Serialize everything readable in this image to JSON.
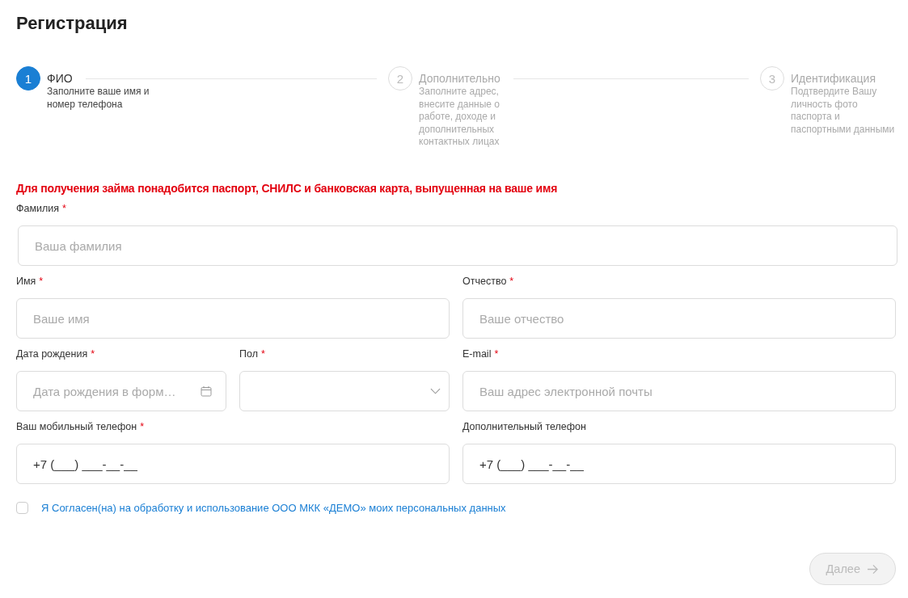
{
  "title": "Регистрация",
  "steps": [
    {
      "number": "1",
      "title": "ФИО",
      "description": "Заполните ваше имя и номер телефона",
      "active": true
    },
    {
      "number": "2",
      "title": "Дополнительно",
      "description": "Заполните адрес, внесите данные о работе, доходе и дополнительных контактных лицах",
      "active": false
    },
    {
      "number": "3",
      "title": "Идентификация",
      "description": "Подтвердите Вашу личность фото паспорта и паспортными данными",
      "active": false
    }
  ],
  "notice": "Для получения займа понадобится паспорт, СНИЛС и банковская карта, выпущенная на ваше имя",
  "field_rows": [
    [
      {
        "kind": "text",
        "label": "Фамилия",
        "required_mark": "*",
        "placeholder": "Ваша фамилия"
      }
    ],
    [
      {
        "kind": "text",
        "label": "Имя",
        "required_mark": "*",
        "placeholder": "Ваше имя"
      },
      {
        "kind": "text",
        "label": "Отчество",
        "required_mark": "*",
        "placeholder": "Ваше отчество"
      }
    ],
    [
      {
        "kind": "date",
        "label": "Дата рождения",
        "required_mark": "*",
        "placeholder": "Дата рождения в форм…"
      },
      {
        "kind": "select",
        "label": "Пол",
        "required_mark": "*"
      },
      {
        "kind": "text",
        "label": "E-mail",
        "required_mark": "*",
        "placeholder": "Ваш адрес электронной почты"
      }
    ],
    [
      {
        "kind": "text",
        "label": "Ваш мобильный телефон",
        "required_mark": "*",
        "value": "+7 (___) ___-__-__"
      },
      {
        "kind": "text",
        "label": "Дополнительный телефон",
        "value": "+7 (___) ___-__-__"
      }
    ]
  ],
  "consent": {
    "label": "Я Согласен(на) на обработку и использование ООО МКК «ДЕМО» моих персональных данных",
    "checked": false
  },
  "next_button": {
    "label": "Далее",
    "disabled": true
  }
}
